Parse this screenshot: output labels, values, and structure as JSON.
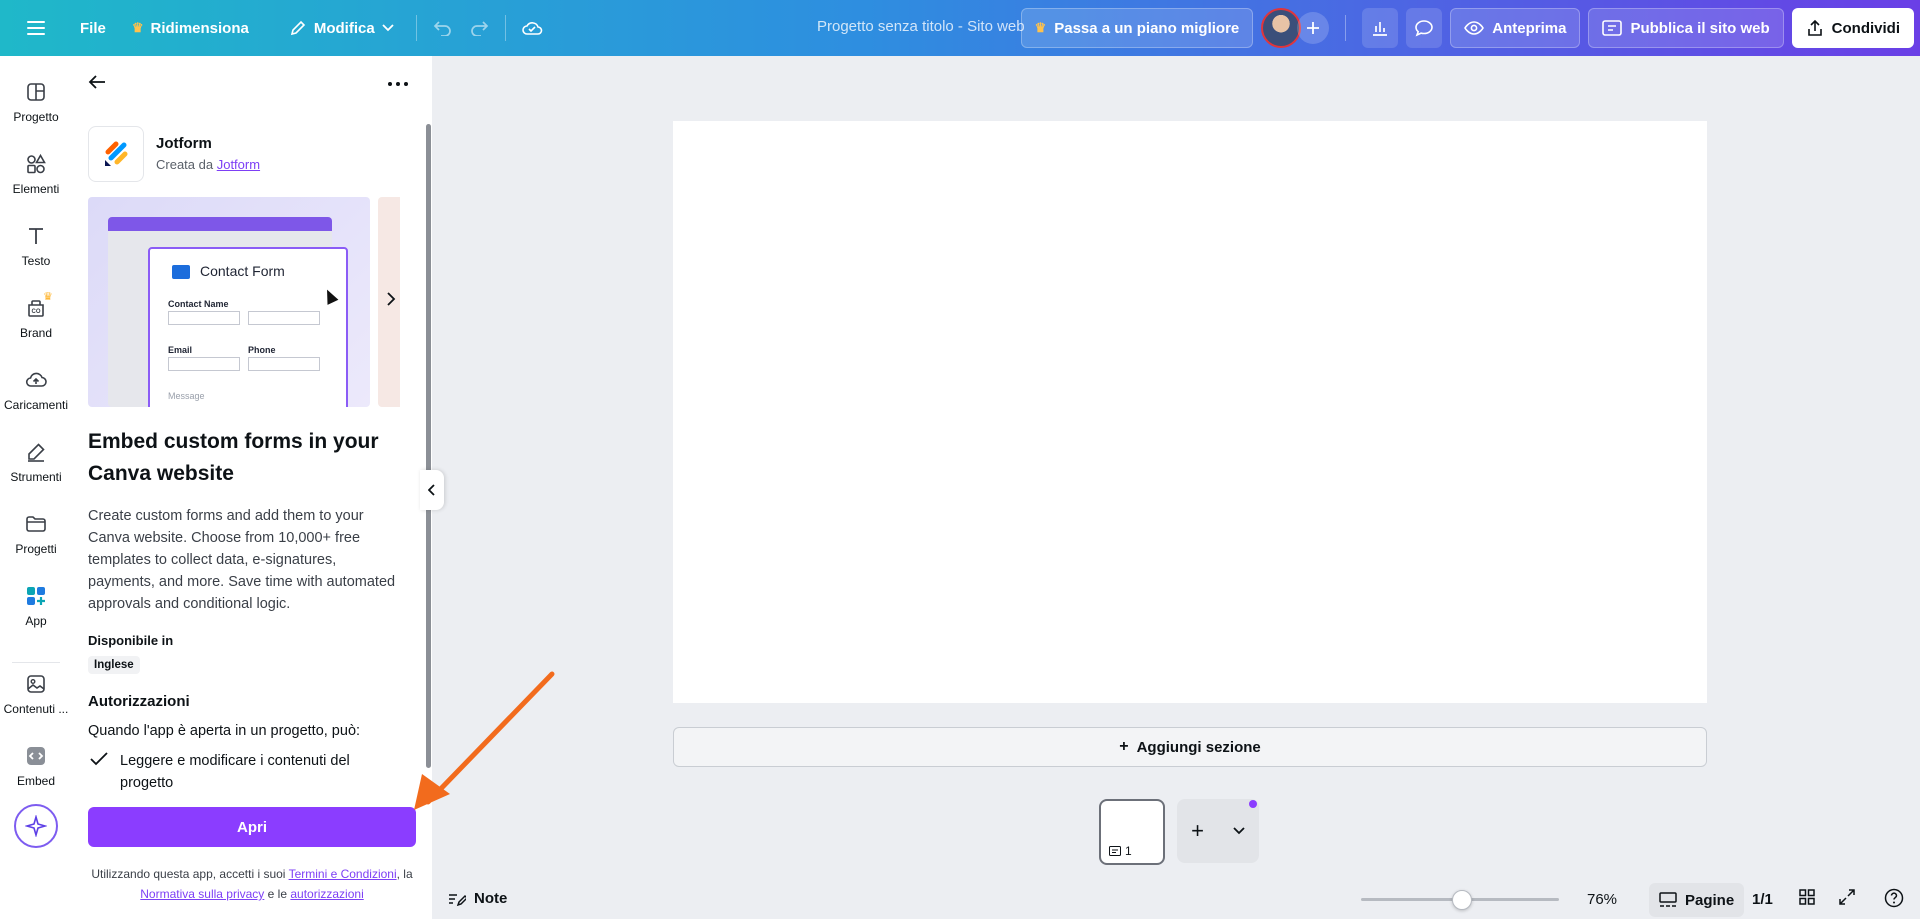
{
  "topbar": {
    "file": "File",
    "resize": "Ridimensiona",
    "edit": "Modifica",
    "title": "Progetto senza titolo - Sito web",
    "upgrade": "Passa a un piano migliore",
    "preview": "Anteprima",
    "publish": "Pubblica il sito web",
    "share": "Condividi"
  },
  "rail": {
    "items": [
      {
        "label": "Progetto",
        "icon": "layout-icon"
      },
      {
        "label": "Elementi",
        "icon": "shapes-icon"
      },
      {
        "label": "Testo",
        "icon": "text-icon"
      },
      {
        "label": "Brand",
        "icon": "brand-icon"
      },
      {
        "label": "Caricamenti",
        "icon": "cloud-upload-icon"
      },
      {
        "label": "Strumenti",
        "icon": "pen-icon"
      },
      {
        "label": "Progetti",
        "icon": "folder-icon"
      },
      {
        "label": "App",
        "icon": "apps-icon"
      },
      {
        "label": "Contenuti ...",
        "icon": "image-icon"
      },
      {
        "label": "Embed",
        "icon": "embed-icon"
      }
    ]
  },
  "panel": {
    "app_name": "Jotform",
    "created_by": "Creata da",
    "creator_link": "Jotform",
    "preview": {
      "form_title": "Contact Form",
      "field_contact_name": "Contact Name",
      "field_email": "Email",
      "field_phone": "Phone",
      "field_message": "Message"
    },
    "heading": "Embed custom forms in your Canva website",
    "description": "Create custom forms and add them to your Canva website. Choose from 10,000+ free templates to collect data, e-signatures, payments, and more. Save time with automated approvals and conditional logic.",
    "available_label": "Disponibile in",
    "language": "Inglese",
    "permissions_title": "Autorizzazioni",
    "permissions_intro": "Quando l'app è aperta in un progetto, può:",
    "permission_1": "Leggere e modificare i contenuti del progetto",
    "open_button": "Apri",
    "legal_prefix": "Utilizzando questa app, accetti i suoi",
    "legal_terms": "Termini e Condizioni",
    "legal_sep": ", la",
    "legal_privacy": "Normativa sulla privacy",
    "legal_and": "e le",
    "legal_auth": "autorizzazioni"
  },
  "canvas": {
    "add_section": "Aggiungi sezione",
    "page_number": "1"
  },
  "footer": {
    "notes": "Note",
    "zoom_value": "76%",
    "zoom_level": 0.76,
    "pages_label": "Pagine",
    "page_count": "1/1"
  },
  "colors": {
    "accent": "#8b3dff",
    "annotation_arrow": "#f26b1d"
  }
}
